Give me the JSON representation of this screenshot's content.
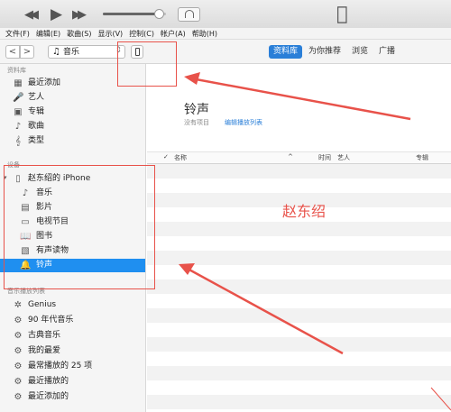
{
  "menu": [
    "文件(F)",
    "编辑(E)",
    "歌曲(S)",
    "显示(V)",
    "控制(C)",
    "帐户(A)",
    "帮助(H)"
  ],
  "player": {
    "volume_percent": 90
  },
  "toolbar": {
    "back": "<",
    "forward": ">",
    "media_label": "音乐"
  },
  "tabs": [
    {
      "label": "资料库",
      "active": true
    },
    {
      "label": "为你推荐",
      "active": false
    },
    {
      "label": "浏览",
      "active": false
    },
    {
      "label": "广播",
      "active": false
    }
  ],
  "sidebar": {
    "library_header": "资料库",
    "library": [
      {
        "label": "最近添加",
        "icon": "grid-icon"
      },
      {
        "label": "艺人",
        "icon": "microphone-icon"
      },
      {
        "label": "专辑",
        "icon": "album-icon"
      },
      {
        "label": "歌曲",
        "icon": "music-note-icon"
      },
      {
        "label": "类型",
        "icon": "genre-icon"
      }
    ],
    "devices_header": "设备",
    "device_name": "赵东绍的 iPhone",
    "device_items": [
      {
        "label": "音乐",
        "icon": "music-note-icon"
      },
      {
        "label": "影片",
        "icon": "film-icon"
      },
      {
        "label": "电视节目",
        "icon": "tv-icon"
      },
      {
        "label": "图书",
        "icon": "book-icon"
      },
      {
        "label": "有声读物",
        "icon": "audiobook-icon"
      },
      {
        "label": "铃声",
        "icon": "bell-icon",
        "selected": true
      }
    ],
    "playlists_header": "音乐播放列表",
    "playlists": [
      {
        "label": "Genius",
        "icon": "genius-icon"
      },
      {
        "label": "90 年代音乐",
        "icon": "gear-icon"
      },
      {
        "label": "古典音乐",
        "icon": "gear-icon"
      },
      {
        "label": "我的最爱",
        "icon": "gear-icon"
      },
      {
        "label": "最常播放的 25 项",
        "icon": "gear-icon"
      },
      {
        "label": "最近播放的",
        "icon": "gear-icon"
      },
      {
        "label": "最近添加的",
        "icon": "gear-icon"
      }
    ]
  },
  "main": {
    "title": "铃声",
    "empty_text": "没有项目",
    "edit_link": "编辑播放列表",
    "columns": {
      "check": "✓",
      "name": "名称",
      "time": "时间",
      "artist": "艺人",
      "album": "专辑"
    }
  },
  "annotation": {
    "watermark": "赵东绍",
    "color": "#e8524a"
  }
}
